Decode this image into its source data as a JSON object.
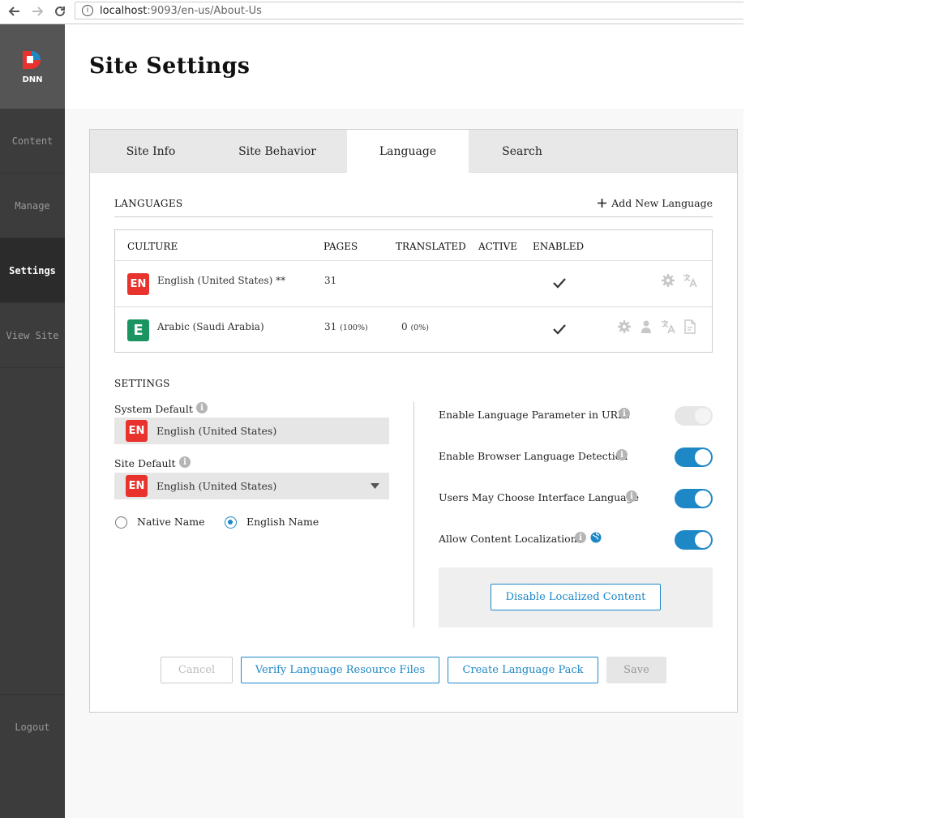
{
  "browser": {
    "url_host": "localhost",
    "url_path": ":9093/en-us/About-Us"
  },
  "sidebar": {
    "logo_text": "DNN",
    "items": [
      {
        "label": "Content"
      },
      {
        "label": "Manage"
      },
      {
        "label": "Settings"
      },
      {
        "label": "View Site"
      }
    ],
    "logout_label": "Logout"
  },
  "page": {
    "title": "Site Settings"
  },
  "tabs": [
    {
      "label": "Site Info"
    },
    {
      "label": "Site Behavior"
    },
    {
      "label": "Language"
    },
    {
      "label": "Search"
    }
  ],
  "languages": {
    "section_title": "LANGUAGES",
    "add_label": "Add New Language",
    "columns": [
      "CULTURE",
      "PAGES",
      "TRANSLATED",
      "ACTIVE",
      "ENABLED"
    ],
    "rows": [
      {
        "culture": "English (United States) **",
        "flag": "EN",
        "flag_color": "#e8322d",
        "pages": "31",
        "pages_pct": "",
        "translated": "",
        "translated_pct": "",
        "enabled": true,
        "icons": [
          "gear-icon",
          "translate-icon"
        ]
      },
      {
        "culture": "Arabic (Saudi Arabia)",
        "flag": "E",
        "flag_color": "#1a9460",
        "pages": "31",
        "pages_pct": "(100%)",
        "translated": "0",
        "translated_pct": "(0%)",
        "enabled": true,
        "icons": [
          "gear-icon",
          "user-icon",
          "translate-icon",
          "file-icon"
        ]
      }
    ]
  },
  "settings": {
    "section_title": "SETTINGS",
    "system_default_label": "System Default",
    "system_default_value": "English (United States)",
    "site_default_label": "Site Default",
    "site_default_value": "English (United States)",
    "radio_native": "Native Name",
    "radio_english": "English Name",
    "radio_selected": "English Name",
    "toggles": [
      {
        "label": "Enable Language Parameter in URLs",
        "on": false,
        "disabled": true
      },
      {
        "label": "Enable Browser Language Detection",
        "on": true,
        "disabled": false
      },
      {
        "label": "Users May Choose Interface Language",
        "on": true,
        "disabled": false
      },
      {
        "label": "Allow Content Localization",
        "on": true,
        "disabled": false
      }
    ],
    "disable_localized_label": "Disable Localized Content"
  },
  "footer": {
    "cancel": "Cancel",
    "verify": "Verify Language Resource Files",
    "create_pack": "Create Language Pack",
    "save": "Save"
  },
  "colors": {
    "accent": "#1e88c7",
    "sidebar_bg": "#3c3c3c",
    "en_flag": "#e8322d",
    "ar_flag": "#1a9460"
  }
}
